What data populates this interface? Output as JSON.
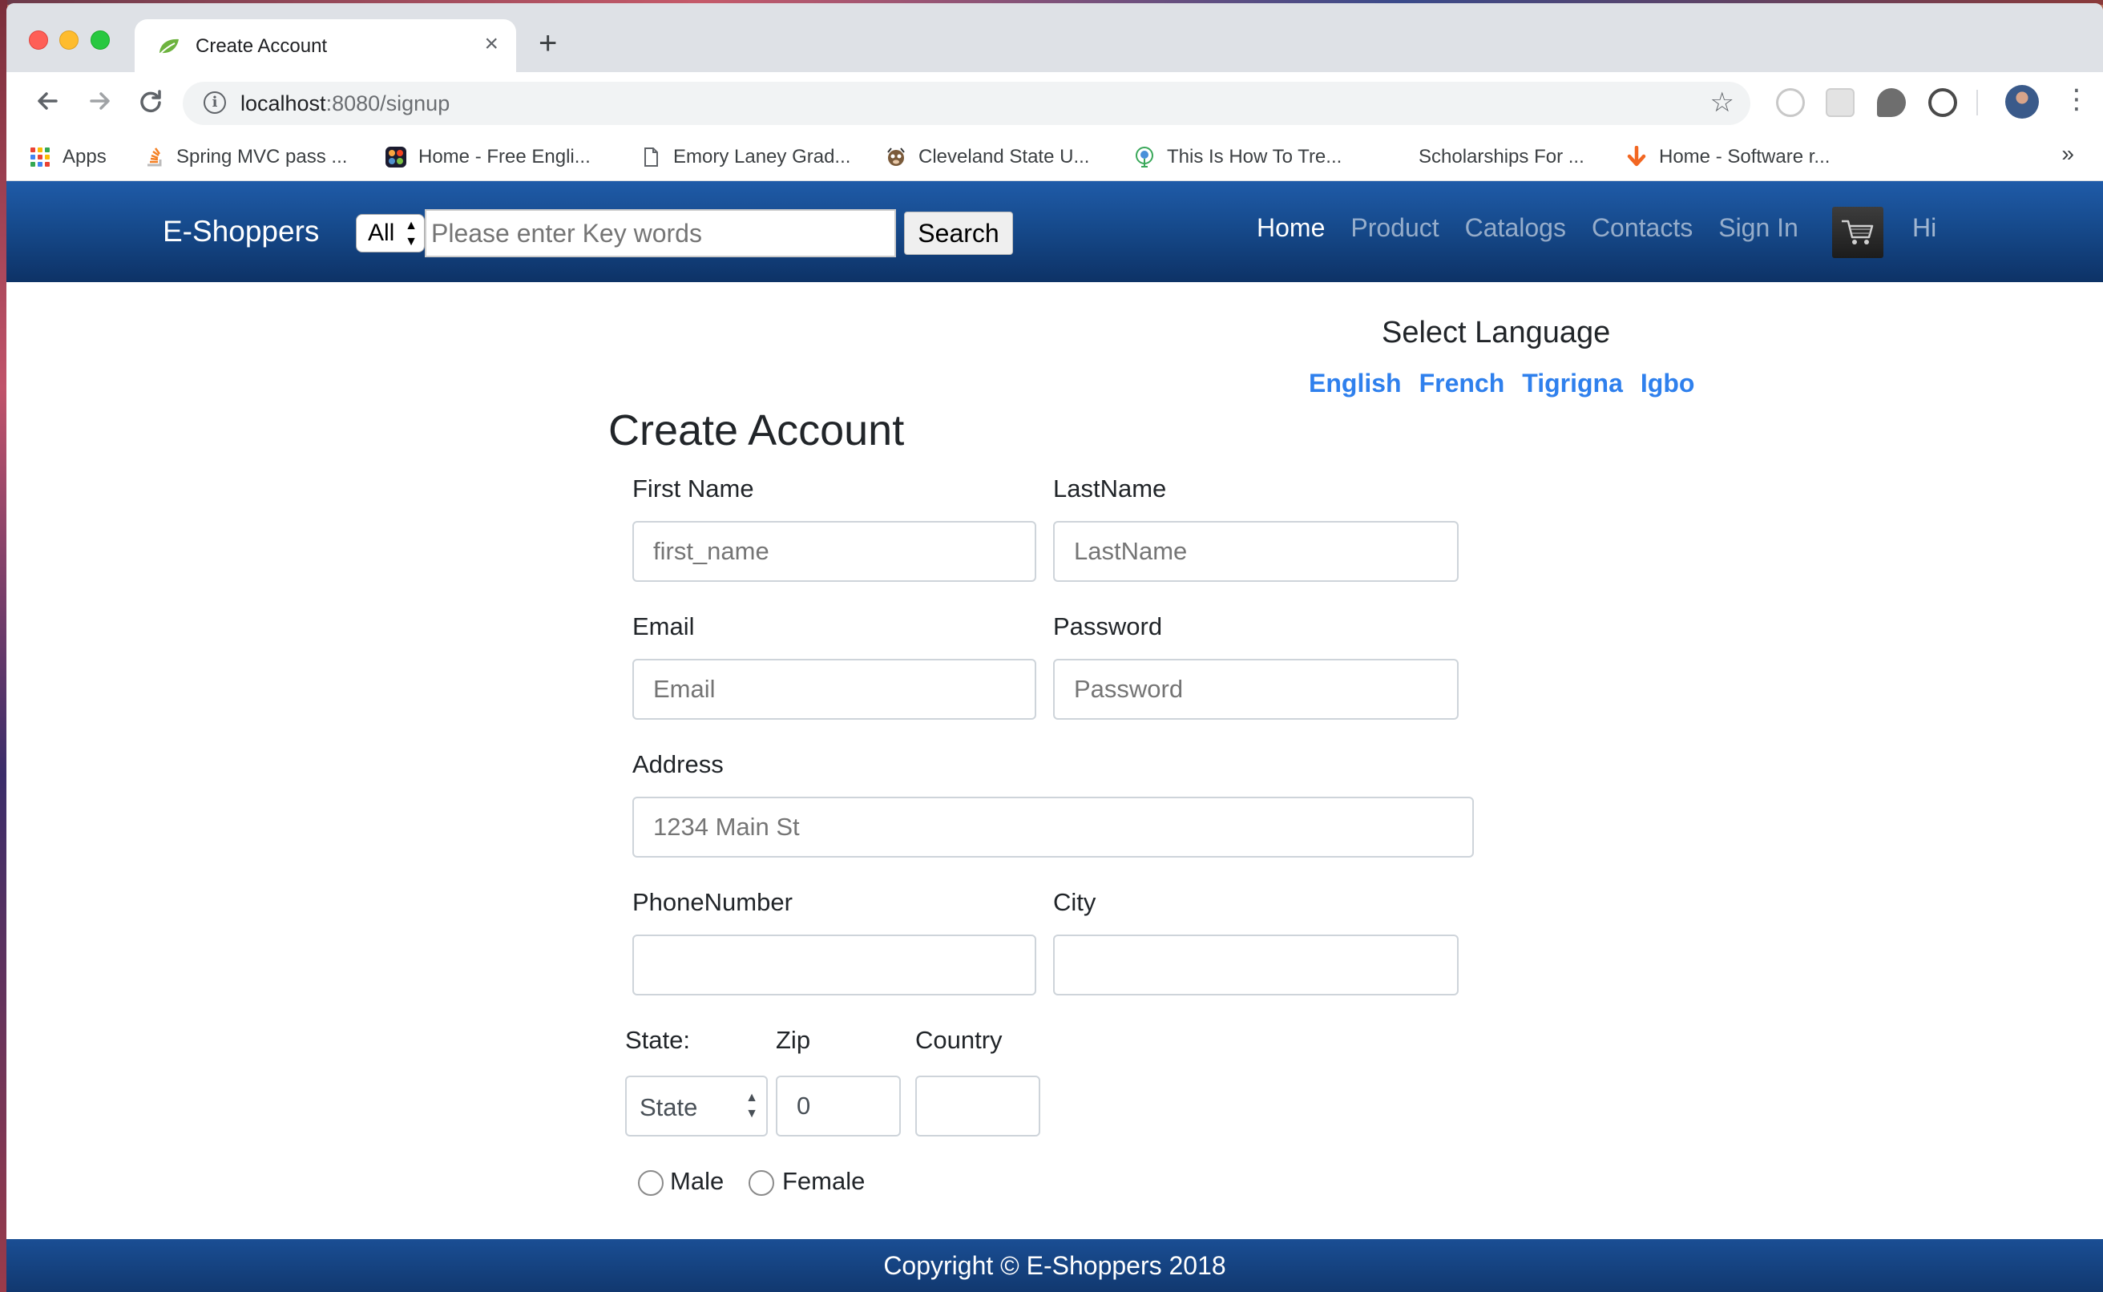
{
  "browser": {
    "tab_title": "Create Account",
    "new_tab": "+",
    "tab_close": "×",
    "url_host": "localhost",
    "url_path": ":8080/signup",
    "bookmarks": [
      {
        "label": "Apps",
        "icon": "apps-grid-icon"
      },
      {
        "label": "Spring MVC pass ...",
        "icon": "stackoverflow-icon"
      },
      {
        "label": "Home - Free Engli...",
        "icon": "joomla-icon"
      },
      {
        "label": "Emory Laney Grad...",
        "icon": "document-icon"
      },
      {
        "label": "Cleveland State U...",
        "icon": "mascot-icon"
      },
      {
        "label": "This Is How To Tre...",
        "icon": "tree-icon"
      },
      {
        "label": "Scholarships For ...",
        "icon": ""
      },
      {
        "label": "Home - Software r...",
        "icon": "down-arrow-icon"
      }
    ],
    "bookmarks_more": "»"
  },
  "navbar": {
    "brand": "E-Shoppers",
    "category_select": "All",
    "search_placeholder": "Please enter Key words",
    "search_button": "Search",
    "links": [
      "Home",
      "Product",
      "Catalogs",
      "Contacts",
      "Sign In"
    ],
    "active_link": "Home",
    "greeting": "Hi"
  },
  "language": {
    "title": "Select Language",
    "options": [
      "English",
      "French",
      "Tigrigna",
      "Igbo"
    ]
  },
  "form": {
    "title": "Create Account",
    "first_name": {
      "label": "First Name",
      "placeholder": "first_name"
    },
    "last_name": {
      "label": "LastName",
      "placeholder": "LastName"
    },
    "email": {
      "label": "Email",
      "placeholder": "Email"
    },
    "password": {
      "label": "Password",
      "placeholder": "Password"
    },
    "address": {
      "label": "Address",
      "placeholder": "1234 Main St"
    },
    "phone": {
      "label": "PhoneNumber",
      "placeholder": ""
    },
    "city": {
      "label": "City",
      "placeholder": ""
    },
    "state": {
      "label": "State:",
      "value": "State"
    },
    "zip": {
      "label": "Zip",
      "value": "0"
    },
    "country": {
      "label": "Country",
      "value": ""
    },
    "gender": {
      "male": "Male",
      "female": "Female"
    }
  },
  "footer": {
    "text": "Copyright © E-Shoppers 2018"
  },
  "colors": {
    "navbar": "#164a8c",
    "link_blue": "#2f80ed"
  }
}
